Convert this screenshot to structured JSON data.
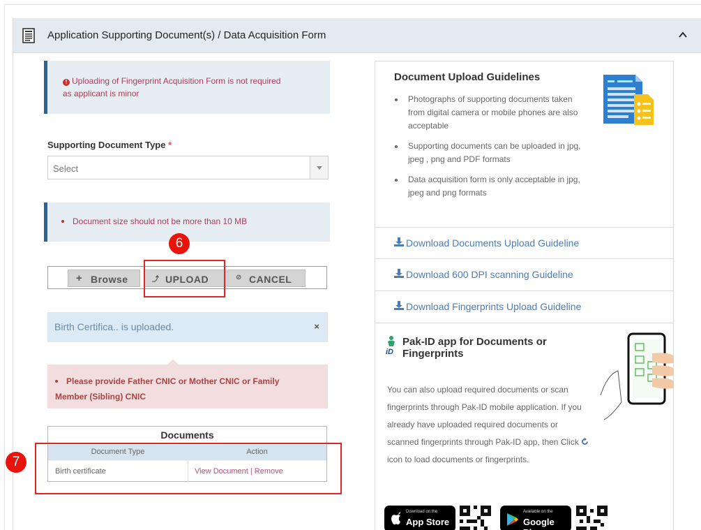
{
  "panel": {
    "title": "Application Supporting Document(s) / Data Acquisition Form",
    "icons": {
      "document": "document-icon",
      "collapse": "chevron-up-icon"
    }
  },
  "fingerprint_alert": {
    "text": "Uploading of Fingerprint Acquisition Form is not required as applicant is minor"
  },
  "supporting_doc": {
    "label": "Supporting Document Type",
    "required_mark": "*",
    "selected": "Select"
  },
  "size_alert": {
    "text": "Document size should not be more than 10 MB"
  },
  "markers": {
    "upload_step": "6",
    "table_step": "7"
  },
  "upload_bar": {
    "browse_label": "Browse",
    "browse_icon": "+",
    "upload_label": "UPLOAD",
    "upload_icon": "⤴",
    "cancel_label": "CANCEL",
    "cancel_icon": "⊘"
  },
  "uploaded_alert": {
    "text": "Birth Certifica.. is uploaded.",
    "close": "×"
  },
  "danger_alert": {
    "text": "Please provide Father CNIC or Mother CNIC or Family Member (Sibling) CNIC"
  },
  "documents": {
    "title": "Documents",
    "columns": [
      "Document Type",
      "Action"
    ],
    "rows": [
      {
        "type": "Birth certificate",
        "action": "View Document | Remove"
      }
    ]
  },
  "guidelines": {
    "title": "Document Upload Guidelines",
    "items": [
      "Photographs of supporting documents taken from digital camera or mobile phones are also acceptable",
      "Supporting documents can be uploaded in jpg, jpeg , png and PDF formats",
      "Data acquisition form is only acceptable in jpg, jpeg and png formats"
    ],
    "links": [
      "Download Documents Upload Guideline",
      "Download 600 DPI scanning Guideline",
      "Download Fingerprints Upload Guideline"
    ]
  },
  "pakid": {
    "title": "Pak-ID app for Documents or Fingerprints",
    "desc_part1": "You can also upload required documents or scan fingerprints through Pak-ID mobile application. If you already have uploaded required documents or scanned fingerprints through Pak-ID app, then Click",
    "desc_part2": "icon to load documents or fingerprints.",
    "appstore_small": "Download on the",
    "appstore_big": "App Store",
    "googleplay_small": "Available on the",
    "googleplay_big": "Google Play"
  },
  "colors": {
    "header_bg": "#e4ebf0",
    "info_border": "#2a6496",
    "alert_text": "#b03a5b",
    "link": "#4a7db8",
    "danger_bg": "#f2dede",
    "marker": "#e8140c"
  }
}
